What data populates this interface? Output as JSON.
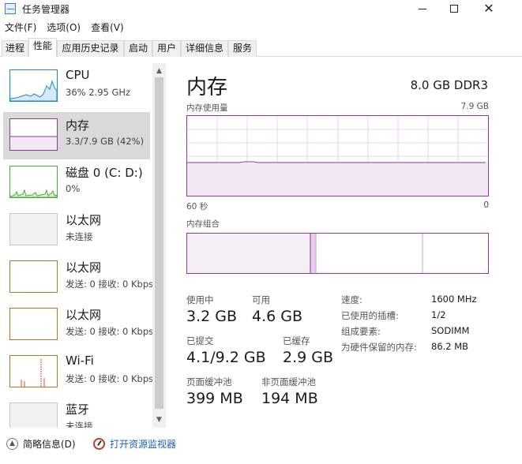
{
  "window": {
    "title": "任务管理器"
  },
  "menu": [
    "文件(F)",
    "选项(O)",
    "查看(V)"
  ],
  "tabs": [
    "进程",
    "性能",
    "应用历史记录",
    "启动",
    "用户",
    "详细信息",
    "服务"
  ],
  "active_tab": "性能",
  "devices": [
    {
      "name": "CPU",
      "sub": "36%  2.95 GHz",
      "color": "#1b87c9",
      "icon": "cpu-graph"
    },
    {
      "name": "内存",
      "sub": "3.3/7.9 GB (42%)",
      "color": "#8b3a9a",
      "icon": "memory-graph",
      "selected": true
    },
    {
      "name": "磁盘 0 (C: D:)",
      "sub": "0%",
      "color": "#4da83a",
      "icon": "disk-graph"
    },
    {
      "name": "以太网",
      "sub": "未连接",
      "color": "#c8c8c8",
      "icon": "ethernet-graph"
    },
    {
      "name": "以太网",
      "sub": "发送: 0  接收: 0 Kbps",
      "color": "#b07a21",
      "icon": "ethernet-graph"
    },
    {
      "name": "以太网",
      "sub": "发送: 0  接收: 0 Kbps",
      "color": "#b07a21",
      "icon": "ethernet-graph"
    },
    {
      "name": "Wi-Fi",
      "sub": "发送: 0  接收: 0 Kbps",
      "color": "#b07a21",
      "icon": "wifi-graph"
    },
    {
      "name": "蓝牙",
      "sub": "未连接",
      "color": "#c8c8c8",
      "icon": "bluetooth-graph"
    }
  ],
  "memory": {
    "title": "内存",
    "spec": "8.0 GB DDR3",
    "usage_label": "内存使用量",
    "usage_max": "7.9 GB",
    "time_left": "60 秒",
    "time_right": "0",
    "composition_label": "内存组合",
    "usage_fraction": 0.42,
    "stats": {
      "in_use_label": "使用中",
      "in_use": "3.2 GB",
      "available_label": "可用",
      "available": "4.6 GB",
      "committed_label": "已提交",
      "committed": "4.1/9.2 GB",
      "cached_label": "已缓存",
      "cached": "2.9 GB",
      "paged_label": "页面缓冲池",
      "paged": "399 MB",
      "nonpaged_label": "非页面缓冲池",
      "nonpaged": "194 MB"
    },
    "details": [
      {
        "key": "速度:",
        "value": "1600 MHz"
      },
      {
        "key": "已使用的插槽:",
        "value": "1/2"
      },
      {
        "key": "组成要素:",
        "value": "SODIMM"
      },
      {
        "key": "为硬件保留的内存:",
        "value": "86.2 MB"
      }
    ]
  },
  "bottom": {
    "summary": "简略信息(D)",
    "resource_monitor": "打开资源监视器"
  },
  "colors": {
    "memory_accent": "#8b3a9a",
    "cpu_accent": "#1b87c9",
    "disk_accent": "#4da83a",
    "network_accent": "#b07a21"
  }
}
